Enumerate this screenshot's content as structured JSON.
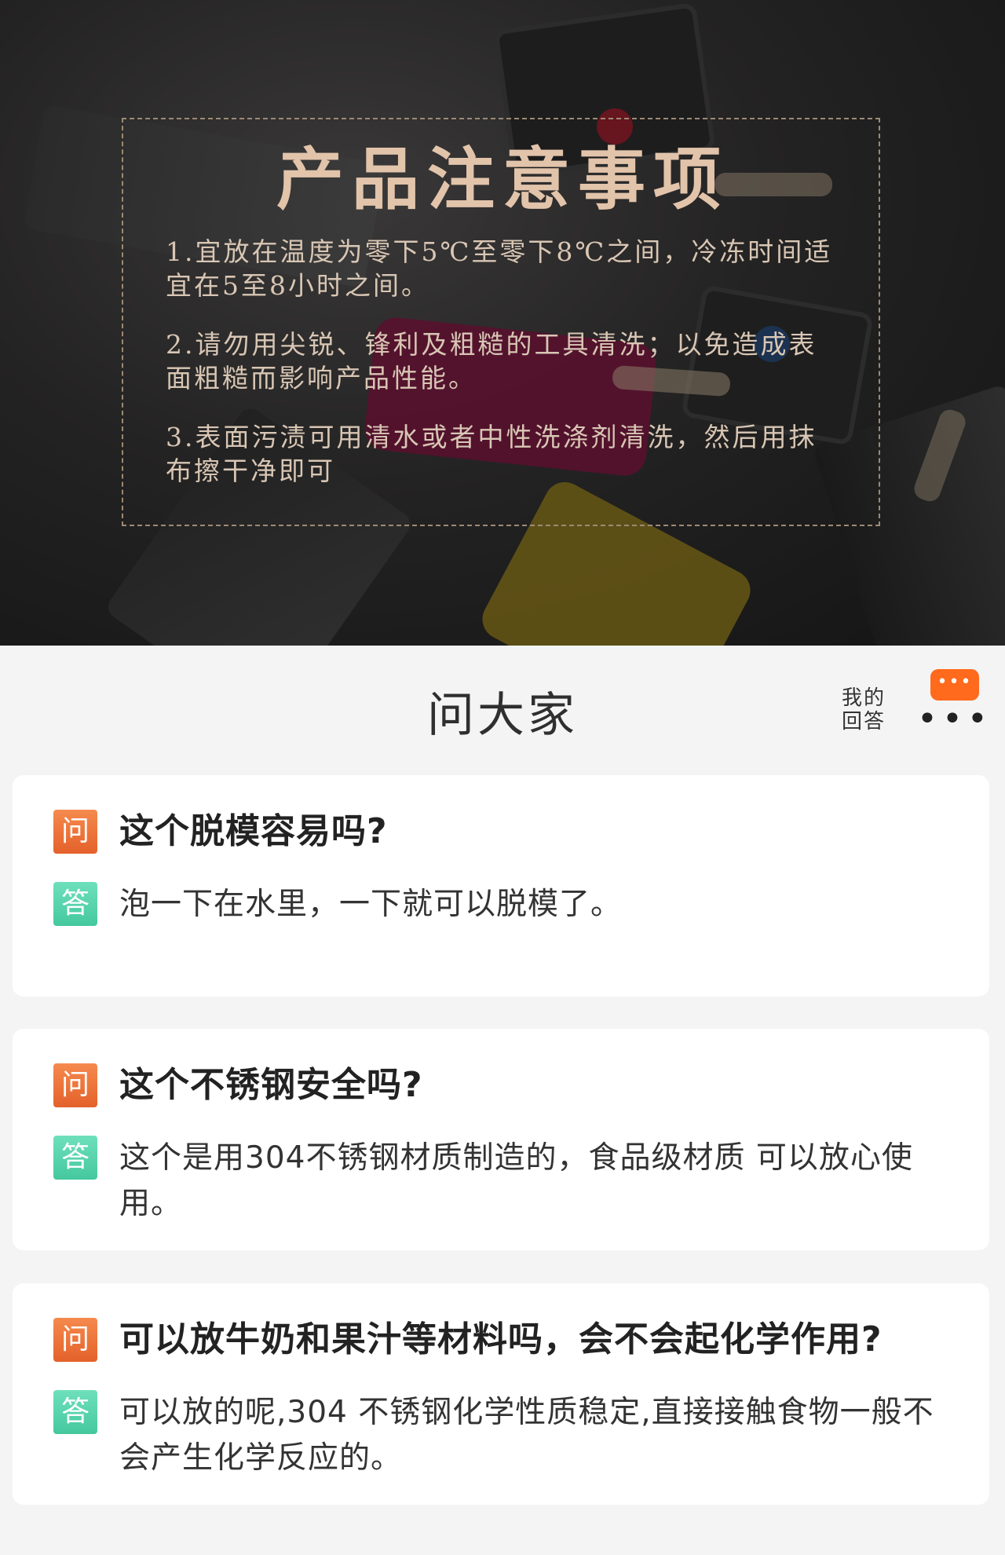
{
  "notice": {
    "title": "产品注意事项",
    "items": [
      "1.宜放在温度为零下5℃至零下8℃之间，冷冻时间适宜在5至8小时之间。",
      "2.请勿用尖锐、锋利及粗糙的工具清洗；以免造成表面粗糙而影响产品性能。",
      "3.表面污渍可用清水或者中性洗涤剂清洗，然后用抹布擦干净即可"
    ]
  },
  "ask": {
    "title": "问大家",
    "my_answers_line1": "我的",
    "my_answers_line2": "回答",
    "badge": "•••",
    "more": "•••"
  },
  "qa": [
    {
      "q_tag": "问",
      "a_tag": "答",
      "question": "这个脱模容易吗?",
      "answer": "泡一下在水里，一下就可以脱模了。"
    },
    {
      "q_tag": "问",
      "a_tag": "答",
      "question": "这个不锈钢安全吗?",
      "answer": "这个是用304不锈钢材质制造的，食品级材质 可以放心使用。"
    },
    {
      "q_tag": "问",
      "a_tag": "答",
      "question": "可以放牛奶和果汁等材料吗，会不会起化学作用?",
      "answer": "可以放的呢,304 不锈钢化学性质稳定,直接接触食物一般不会产生化学反应的。"
    }
  ],
  "colors": {
    "accent_orange": "#ff6a1c",
    "question_tag": "#e4612a",
    "answer_tag": "#45c89e",
    "notice_gold": "#e2c4ab"
  }
}
